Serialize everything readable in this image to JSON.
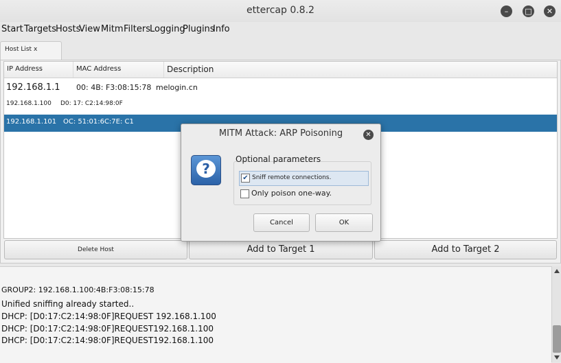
{
  "window": {
    "title": "ettercap 0.8.2"
  },
  "menubar": [
    "Start",
    "Targets",
    "Hosts",
    "View",
    "Mitm",
    "Filters",
    "Logging",
    "Plugins",
    "Info"
  ],
  "tab": {
    "label": "Host List x"
  },
  "host_list": {
    "columns": [
      "IP Address",
      "MAC Address",
      "Description"
    ],
    "rows": [
      {
        "ip": "192.168.1.1",
        "mac": "00:  4B: F3:08:15:78",
        "desc": "melogin.cn"
      },
      {
        "ip": "192.168.1.100",
        "mac": "D0:  17: C2:14:98:0F",
        "desc": ""
      },
      {
        "ip": "192.168.1.101",
        "mac": "OC:  51:01:6C:7E: C1",
        "desc": ""
      }
    ]
  },
  "buttons": {
    "delete_host": "Delete Host",
    "add_target1": "Add to Target 1",
    "add_target2": "Add to Target 2"
  },
  "dialog": {
    "title": "MITM Attack: ARP Poisoning",
    "group_label": "Optional parameters",
    "option1": "Sniff remote connections.",
    "option1_checked": true,
    "option2": "Only poison one-way.",
    "option2_checked": false,
    "cancel": "Cancel",
    "ok": "OK",
    "check_glyph": "✔"
  },
  "log": [
    "GROUP2: 192.168.1.100:4B:F3:08:15:78",
    "Unified sniffing already started..",
    "DHCP: [D0:17:C2:14:98:0F]REQUEST 192.168.1.100",
    "DHCP: [D0:17:C2:14:98:0F]REQUEST192.168.1.100",
    "DHCP: [D0:17:C2:14:98:0F]REQUEST192.168.1.100"
  ],
  "icons": {
    "minimize": "minimize-icon",
    "maximize": "maximize-icon",
    "close": "close-icon",
    "question": "question-icon"
  },
  "colors": {
    "selection": "#2a73a8",
    "icon_blue": "#2b62a8"
  }
}
